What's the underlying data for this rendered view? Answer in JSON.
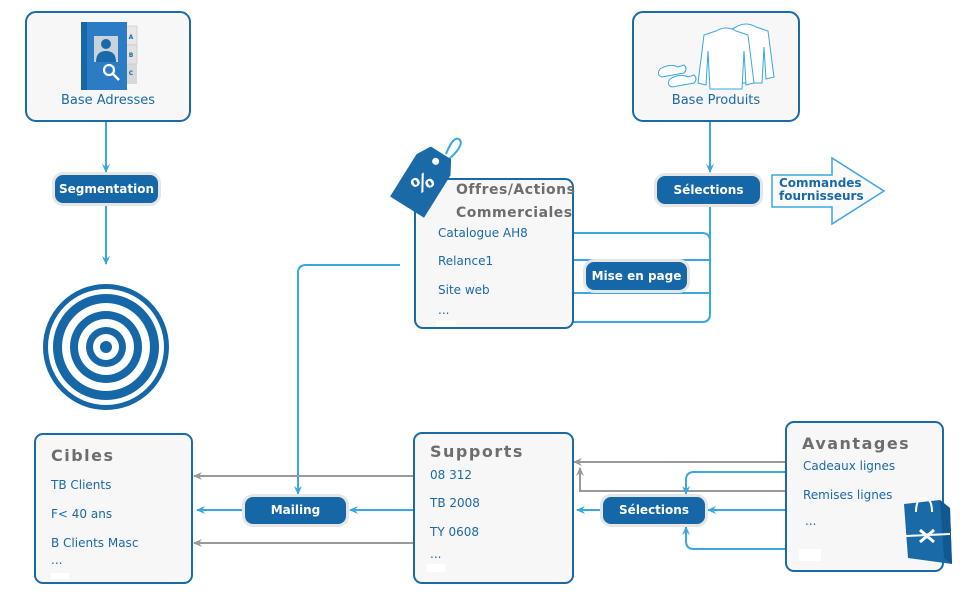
{
  "colors": {
    "primary": "#1567a8",
    "border": "#1a6aa8",
    "connector_blue": "#3aa7e0",
    "connector_gray": "#999999",
    "title_gray": "#6d6d6d",
    "box_bg": "#f7f7f7"
  },
  "nodes": {
    "base_adresses": {
      "label": "Base Adresses",
      "icon": "address-book-icon"
    },
    "base_produits": {
      "label": "Base Produits",
      "icon": "clothes-shoes-icon"
    },
    "segmentation": {
      "label": "Segmentation"
    },
    "selections_top": {
      "label": "Sélections"
    },
    "commandes": {
      "line1": "Commandes",
      "line2": "fournisseurs"
    },
    "target": {
      "icon": "target-icon"
    },
    "offres": {
      "title_line1": "Offres/Actions",
      "title_line2": "Commerciales",
      "icon": "price-tag-percent-icon",
      "tag_symbol": "%",
      "items": [
        "Catalogue AH8",
        "Relance1",
        "Site web",
        "..."
      ]
    },
    "mise_en_page": {
      "label": "Mise en page"
    },
    "cibles": {
      "title": "Cibles",
      "items": [
        "TB Clients",
        "F< 40 ans",
        "B Clients Masc",
        "..."
      ]
    },
    "mailing": {
      "label": "Mailing"
    },
    "supports": {
      "title": "Supports",
      "items": [
        "08 312",
        "TB 2008",
        "TY 0608",
        "..."
      ]
    },
    "selections_bottom": {
      "label": "Sélections"
    },
    "avantages": {
      "title": "Avantages",
      "icon": "shopping-bag-icon",
      "items": [
        "Cadeaux lignes",
        "Remises lignes",
        "..."
      ]
    }
  }
}
